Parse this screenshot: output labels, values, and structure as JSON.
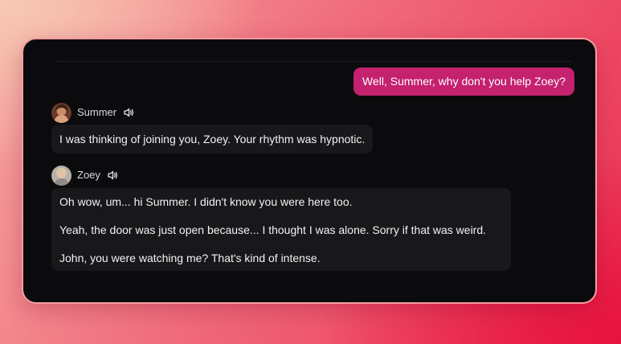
{
  "conversation": {
    "user_message": "Well, Summer, why don't you help Zoey?",
    "messages": [
      {
        "speaker": "Summer",
        "avatar": "summer-avatar",
        "audio_icon": "speaker-icon",
        "paragraphs": [
          "I was thinking of joining you, Zoey. Your rhythm was hypnotic."
        ]
      },
      {
        "speaker": "Zoey",
        "avatar": "zoey-avatar",
        "audio_icon": "speaker-icon",
        "paragraphs": [
          "Oh wow, um... hi Summer. I didn't know you were here too.",
          "Yeah, the door was just open because... I thought I was alone. Sorry if that was weird.",
          "John, you were watching me? That's kind of intense."
        ]
      }
    ]
  },
  "colors": {
    "user_bubble": "#c4216f",
    "panel_background": "#0b0b0d",
    "message_background": "#18181b",
    "frame_border": "#f59ca0"
  }
}
